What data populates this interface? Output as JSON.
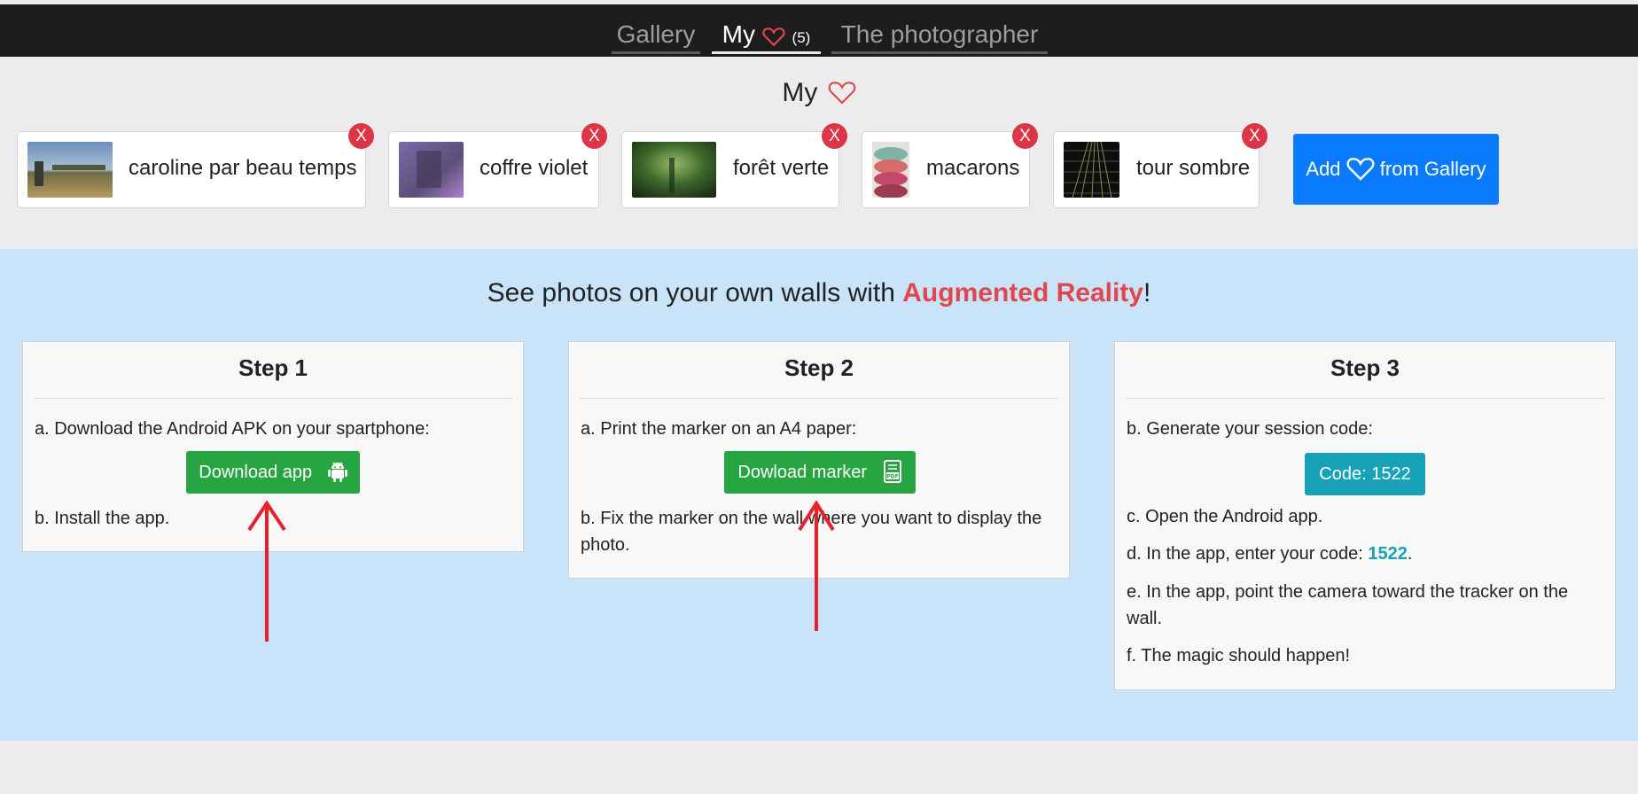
{
  "nav": {
    "tabs": [
      {
        "label": "Gallery"
      },
      {
        "label": "My",
        "count": "(5)"
      },
      {
        "label": "The photographer"
      }
    ]
  },
  "favorites": {
    "title": "My",
    "items": [
      {
        "label": "caroline par beau temps",
        "remove": "X"
      },
      {
        "label": "coffre violet",
        "remove": "X"
      },
      {
        "label": "forêt verte",
        "remove": "X"
      },
      {
        "label": "macarons",
        "remove": "X"
      },
      {
        "label": "tour sombre",
        "remove": "X"
      }
    ],
    "add_before": "Add",
    "add_after": "from Gallery"
  },
  "ar": {
    "title_prefix": "See photos on your own walls with ",
    "title_highlight": "Augmented Reality",
    "title_suffix": "!",
    "steps": [
      {
        "title": "Step 1",
        "a": "a. Download the Android APK on your spartphone:",
        "button": "Download app",
        "b": "b. Install the app."
      },
      {
        "title": "Step 2",
        "a": "a. Print the marker on an A4 paper:",
        "button": "Dowload marker",
        "b": "b. Fix the marker on the wall where you want to display the photo."
      },
      {
        "title": "Step 3",
        "b": "b. Generate your session code:",
        "button": "Code: 1522",
        "c": "c. Open the Android app.",
        "d_prefix": "d. In the app, enter your code: ",
        "d_code": "1522",
        "d_suffix": ".",
        "e": "e. In the app, point the camera toward the tracker on the wall.",
        "f": "f. The magic should happen!"
      }
    ]
  },
  "colors": {
    "navbar": "#1d1d1d",
    "heart": "#e0474c",
    "remove": "#dc3545",
    "primary": "#0a7bff",
    "success": "#27a543",
    "info": "#17a2b8",
    "ar_bg": "#c9e4f8",
    "arrow": "#e8202a"
  },
  "icons": [
    "heart-outline-icon",
    "android-icon",
    "pdf-file-icon",
    "up-arrow-annotation"
  ]
}
